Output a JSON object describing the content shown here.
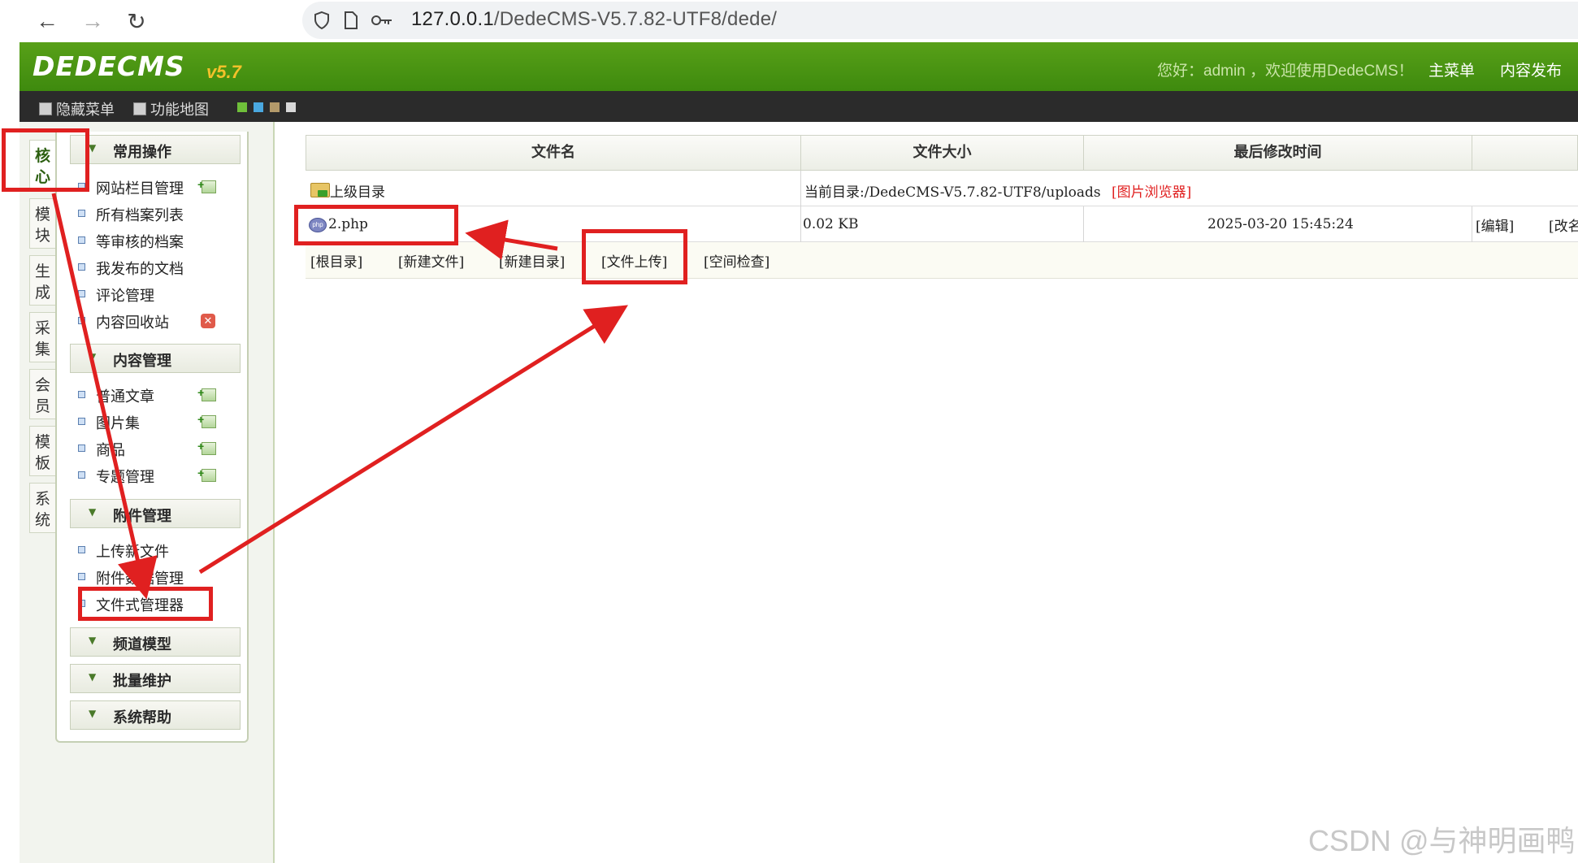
{
  "browser": {
    "url_host": "127.0.0.1",
    "url_path": "/DedeCMS-V5.7.82-UTF8/dede/"
  },
  "header": {
    "logo_text": "DEDECMS",
    "logo_version": "v5.7",
    "greeting": "您好：admin ，欢迎使用DedeCMS！",
    "links": [
      "主菜单",
      "内容发布"
    ]
  },
  "toolbar": {
    "hide_menu": "隐藏菜单",
    "func_map": "功能地图"
  },
  "side_tabs": [
    "核心",
    "模块",
    "生成",
    "采集",
    "会员",
    "模板",
    "系统"
  ],
  "menu": {
    "groups": [
      {
        "label": "常用操作",
        "items": [
          "网站栏目管理",
          "所有档案列表",
          "等审核的档案",
          "我发布的文档",
          "评论管理",
          "内容回收站"
        ]
      },
      {
        "label": "内容管理",
        "items": [
          "普通文章",
          "图片集",
          "商品",
          "专题管理"
        ]
      },
      {
        "label": "附件管理",
        "items": [
          "上传新文件",
          "附件数据管理",
          "文件式管理器"
        ]
      },
      {
        "label": "频道模型",
        "items": []
      },
      {
        "label": "批量维护",
        "items": []
      },
      {
        "label": "系统帮助",
        "items": []
      }
    ]
  },
  "file_table": {
    "headers": [
      "文件名",
      "文件大小",
      "最后修改时间"
    ],
    "parent_dir": "上级目录",
    "current_dir": "当前目录:/DedeCMS-V5.7.82-UTF8/uploads",
    "image_browser": "[图片浏览器]",
    "files": [
      {
        "name": "2.php",
        "size": "0.02 KB",
        "mtime": "2025-03-20 15:45:24",
        "actions": [
          "[编辑]",
          "[改名]"
        ]
      }
    ],
    "actions": [
      "[根目录]",
      "[新建文件]",
      "[新建目录]",
      "[文件上传]",
      "[空间检查]"
    ]
  },
  "watermark": "CSDN @与神明画鸭",
  "colors": {
    "header_green": "#4a9414",
    "toolbar_dark": "#2b2b2b",
    "annotation_red": "#e02020"
  }
}
